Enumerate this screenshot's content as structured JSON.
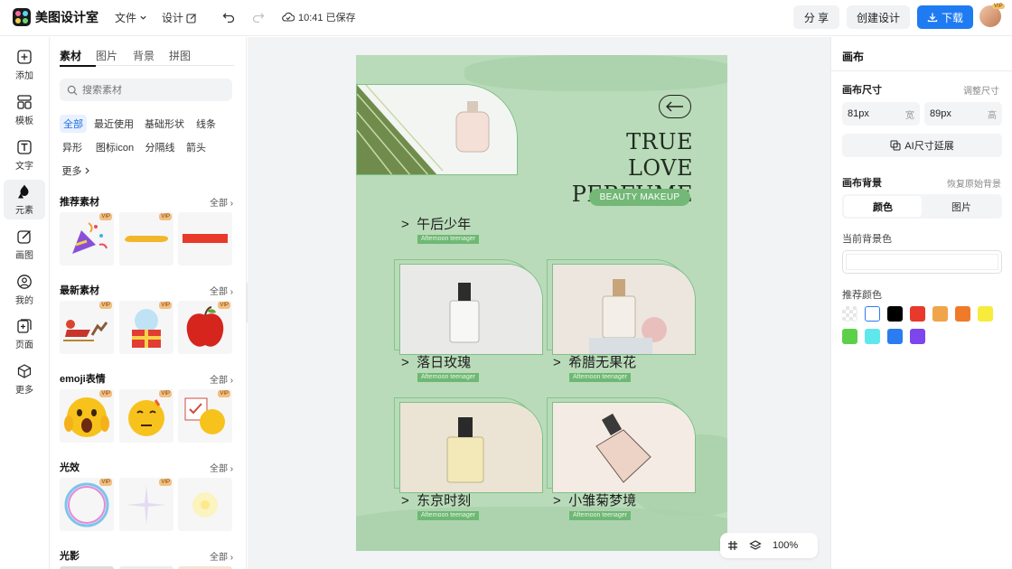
{
  "app": {
    "name": "美图设计室",
    "saved_status": "10:41 已保存"
  },
  "topbar": {
    "file_menu": "文件",
    "design_menu": "设计",
    "share": "分 享",
    "create_design": "创建设计",
    "download": "下载",
    "vip_badge": "VIP"
  },
  "rail": [
    {
      "label": "添加",
      "icon": "plus-square-icon"
    },
    {
      "label": "模板",
      "icon": "template-icon"
    },
    {
      "label": "文字",
      "icon": "text-icon"
    },
    {
      "label": "元素",
      "icon": "shapes-icon"
    },
    {
      "label": "画图",
      "icon": "pencil-icon"
    },
    {
      "label": "我的",
      "icon": "user-icon"
    },
    {
      "label": "页面",
      "icon": "page-add-icon"
    },
    {
      "label": "更多",
      "icon": "cube-icon"
    }
  ],
  "panel": {
    "tabs": [
      "素材",
      "图片",
      "背景",
      "拼图"
    ],
    "search_placeholder": "搜索素材",
    "chips": [
      "全部",
      "最近使用",
      "基础形状",
      "线条",
      "异形",
      "图标icon",
      "分隔线",
      "箭头",
      "更多"
    ],
    "sections": [
      {
        "title": "推荐素材",
        "all": "全部"
      },
      {
        "title": "最新素材",
        "all": "全部"
      },
      {
        "title": "emoji表情",
        "all": "全部"
      },
      {
        "title": "光效",
        "all": "全部"
      },
      {
        "title": "光影",
        "all": "全部"
      }
    ],
    "vip": "VIP"
  },
  "poster": {
    "title_line1": "TRUE LOVE",
    "title_line2": "PERFUME",
    "tag": "BEAUTY MAKEUP",
    "items": [
      {
        "title": "午后少年",
        "sub": "Afternoon teenager"
      },
      {
        "title": "落日玫瑰",
        "sub": "Afternoon teenager"
      },
      {
        "title": "希腊无果花",
        "sub": "Afternoon teenager"
      },
      {
        "title": "东京时刻",
        "sub": "Afternoon teenager"
      },
      {
        "title": "小雏菊梦境",
        "sub": "Afternoon teenager"
      }
    ],
    "bg_color": "#b9dbb9"
  },
  "canvas_tools": {
    "zoom": "100%"
  },
  "right_panel": {
    "title": "画布",
    "size_label": "画布尺寸",
    "resize_link": "调整尺寸",
    "width_value": "81px",
    "width_unit": "宽",
    "height_value": "89px",
    "height_unit": "高",
    "ai_button": "AI尺寸延展",
    "bg_label": "画布背景",
    "restore_link": "恢复原始背景",
    "seg_color": "颜色",
    "seg_image": "图片",
    "current_bg_label": "当前背景色",
    "recommend_label": "推荐颜色",
    "colors": [
      "transparent",
      "#ffffff",
      "#000000",
      "#e8392b",
      "#f1a54a",
      "#ee7a2a",
      "#f7ec3c",
      "#5dd04a",
      "#5fe8ec",
      "#2b7cf0",
      "#7d45ee"
    ]
  }
}
